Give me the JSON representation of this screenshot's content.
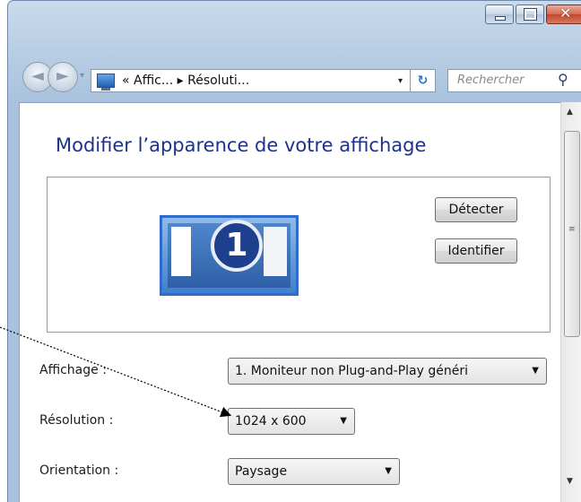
{
  "window": {
    "caption_buttons": {
      "minimize": "–",
      "maximize": "□",
      "close": "✕"
    }
  },
  "nav": {
    "back_glyph": "◄",
    "forward_glyph": "►",
    "history_drop": "▾",
    "address": "« Affic... ▸ Résoluti...",
    "address_drop": "▾",
    "refresh_glyph": "↻",
    "search_placeholder": "Rechercher",
    "search_glyph": "⚲"
  },
  "content": {
    "title": "Modifier l’apparence de votre affichage",
    "monitor_number": "1",
    "detect_button": "Détecter",
    "identify_button": "Identifier",
    "display_label": "Affichage :",
    "display_value": "1. Moniteur non Plug-and-Play généri",
    "resolution_label": "Résolution :",
    "resolution_value": "1024 x 600",
    "orientation_label": "Orientation :",
    "orientation_value": "Paysage",
    "combo_arrow": "▼"
  },
  "scrollbar": {
    "up": "▲",
    "grip": "≡",
    "down": "▼"
  },
  "colors": {
    "title": "#1e3287",
    "accent": "#2d6cc8",
    "close": "#c1452b"
  }
}
